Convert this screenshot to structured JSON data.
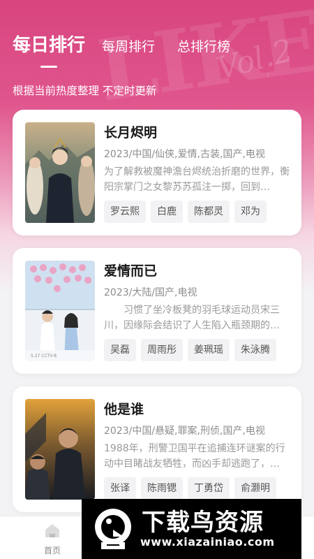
{
  "header": {
    "tabs": [
      {
        "label": "每日排行",
        "active": true
      },
      {
        "label": "每周排行",
        "active": false
      },
      {
        "label": "总排行榜",
        "active": false
      }
    ],
    "subtitle": "根据当前热度整理 不定时更新"
  },
  "shows": [
    {
      "title": "长月烬明",
      "meta": "2023/中国/仙侠,爱情,古装,国产,电视",
      "description": "为了解救被魔神澹台烬统治折磨的世界，衡阳宗掌门之女黎苏苏孤注一掷，回到…",
      "cast": [
        "罗云熙",
        "白鹿",
        "陈都灵",
        "邓为"
      ]
    },
    {
      "title": "爱情而已",
      "meta": "2023/大陆/国产,电视",
      "description": "　　习惯了坐冷板凳的羽毛球运动员宋三川，因缘际会结识了人生陷入瓶颈期的…",
      "cast": [
        "吴磊",
        "周雨彤",
        "姜珮瑶",
        "朱泳腾"
      ]
    },
    {
      "title": "他是谁",
      "meta": "2023/中国/悬疑,罪案,刑侦,国产,电视",
      "description": "1988年，刑警卫国平在追捕连环谜案的行动中目睹战友牺牲，而凶手却逃跑了，…",
      "cast": [
        "张译",
        "陈雨锶",
        "丁勇岱",
        "俞灏明"
      ]
    }
  ],
  "bottom_nav": {
    "home_label": "首页"
  },
  "watermark": {
    "title": "下载鸟资源",
    "url": "www.xiazainiao.com"
  }
}
